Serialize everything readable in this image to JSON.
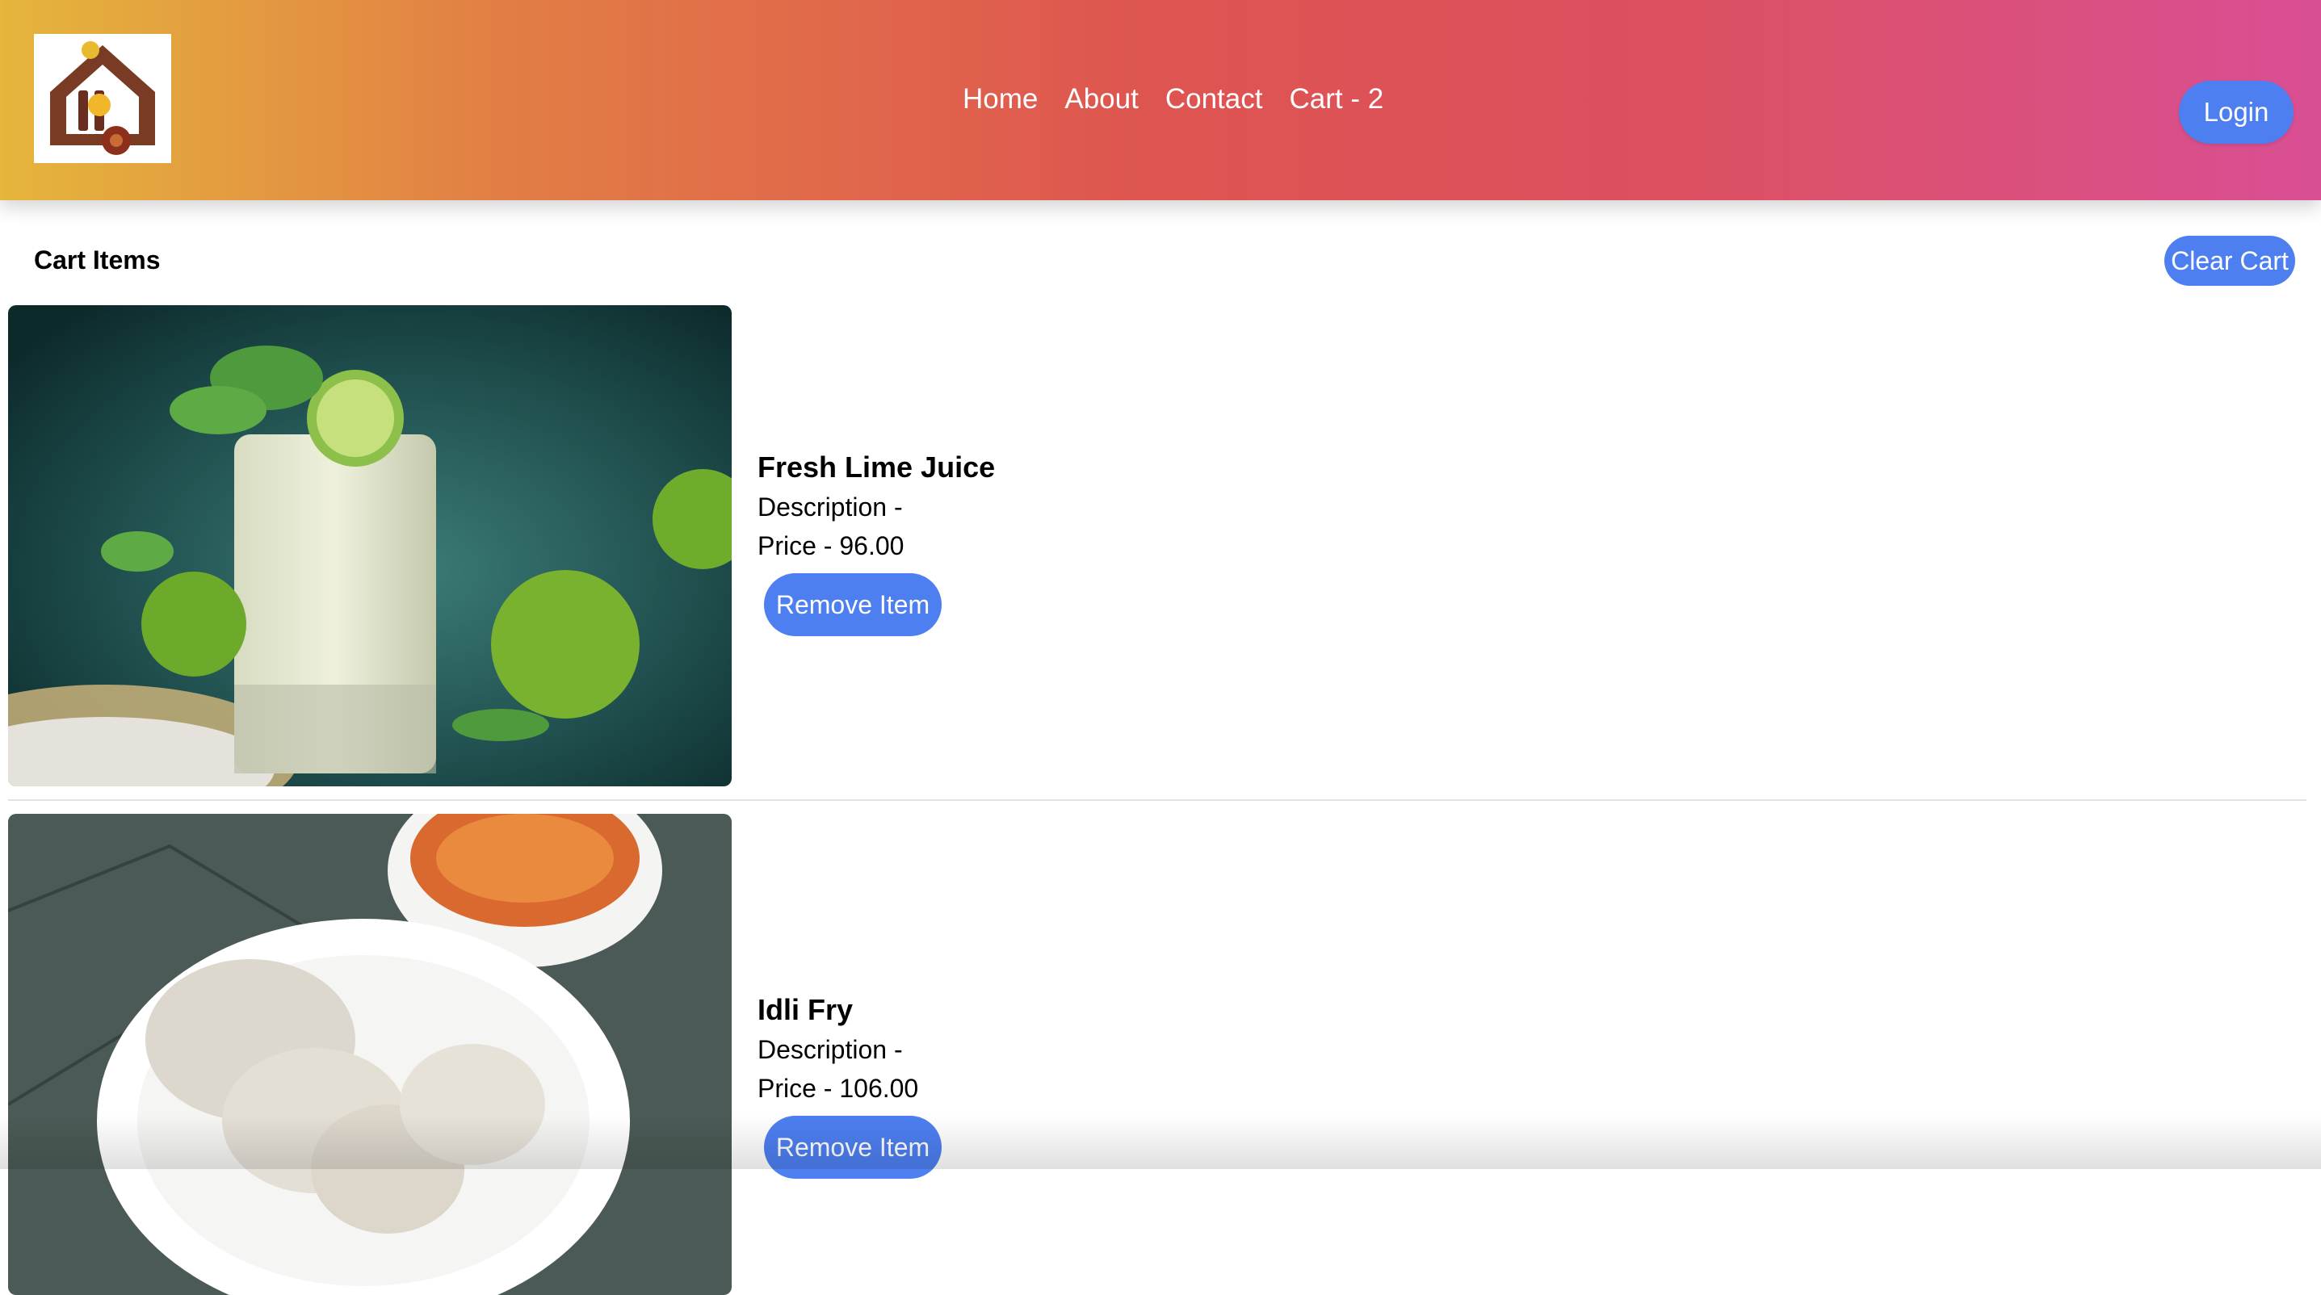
{
  "header": {
    "nav": [
      "Home",
      "About",
      "Contact",
      "Cart - 2"
    ],
    "login_label": "Login",
    "logo_icon": "home-food-logo-icon"
  },
  "cart": {
    "title": "Cart Items",
    "clear_label": "Clear Cart",
    "items": [
      {
        "name": "Fresh Lime Juice",
        "description": "Description -",
        "price": "Price - 96.00",
        "remove_label": "Remove Item",
        "image": "fresh-lime-juice-image"
      },
      {
        "name": "Idli Fry",
        "description": "Description -",
        "price": "Price - 106.00",
        "remove_label": "Remove Item",
        "image": "idli-fry-image"
      }
    ]
  },
  "colors": {
    "accent": "#4d7ff0",
    "header_gradient": [
      "#e5b53c",
      "#de5450",
      "#d94f94"
    ]
  }
}
